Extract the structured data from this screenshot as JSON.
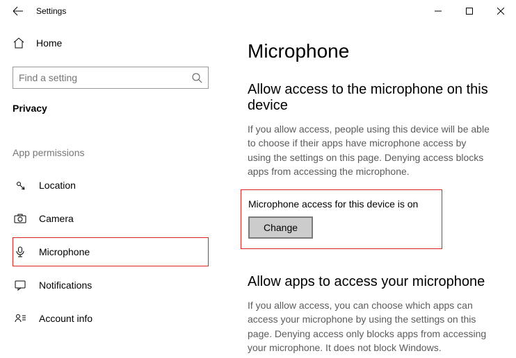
{
  "window": {
    "title": "Settings"
  },
  "sidebar": {
    "home_label": "Home",
    "search_placeholder": "Find a setting",
    "section_title": "Privacy",
    "group_label": "App permissions",
    "items": [
      {
        "label": "Location"
      },
      {
        "label": "Camera"
      },
      {
        "label": "Microphone"
      },
      {
        "label": "Notifications"
      },
      {
        "label": "Account info"
      }
    ],
    "selected_index": 2
  },
  "main": {
    "title": "Microphone",
    "section1": {
      "heading": "Allow access to the microphone on this device",
      "desc": "If you allow access, people using this device will be able to choose if their apps have microphone access by using the settings on this page. Denying access blocks apps from accessing the microphone.",
      "status": "Microphone access for this device is on",
      "button": "Change"
    },
    "section2": {
      "heading": "Allow apps to access your microphone",
      "desc": "If you allow access, you can choose which apps can access your microphone by using the settings on this page. Denying access only blocks apps from accessing your microphone. It does not block Windows."
    }
  }
}
